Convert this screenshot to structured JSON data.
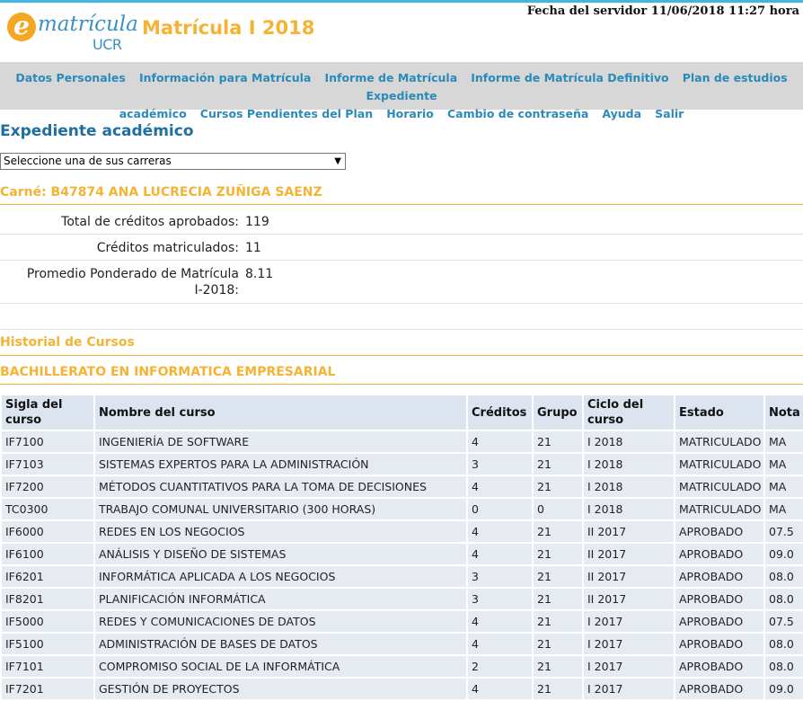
{
  "header": {
    "server_time": "Fecha del servidor 11/06/2018 11:27 hora",
    "logo_e": "e",
    "logo_word": "matrícula",
    "logo_ucr": "UCR",
    "app_title": "Matrícula I 2018"
  },
  "nav": {
    "items": [
      "Datos Personales",
      "Información para Matrícula",
      "Informe de Matrícula",
      "Informe de Matrícula Definitivo",
      "Plan de estudios",
      "Expediente",
      "académico",
      "Cursos Pendientes del Plan",
      "Horario",
      "Cambio de contraseña",
      "Ayuda",
      "Salir"
    ]
  },
  "page": {
    "heading": "Expediente académico",
    "career_select_value": "Seleccione una de sus carreras",
    "carne": "Carné: B47874 ANA LUCRECIA ZUÑIGA SAENZ"
  },
  "summary": {
    "approved_label": "Total de créditos aprobados:",
    "approved_value": "119",
    "enrolled_label": "Créditos matriculados:",
    "enrolled_value": "11",
    "average_label_1": "Promedio Ponderado de Matrícula",
    "average_label_2": "I-2018:",
    "average_value": "8.11"
  },
  "history": {
    "title": "Historial de Cursos",
    "program": "BACHILLERATO EN INFORMATICA EMPRESARIAL"
  },
  "table": {
    "headers": {
      "sigla_1": "Sigla del",
      "sigla_2": "curso",
      "nombre": "Nombre del curso",
      "creditos": "Créditos",
      "grupo": "Grupo",
      "ciclo_1": "Ciclo del",
      "ciclo_2": "curso",
      "estado": "Estado",
      "nota": "Nota"
    },
    "rows": [
      [
        "IF7100",
        "INGENIERÍA DE SOFTWARE",
        "4",
        "21",
        "I 2018",
        "MATRICULADO",
        "MA"
      ],
      [
        "IF7103",
        "SISTEMAS EXPERTOS PARA LA ADMINISTRACIÓN",
        "3",
        "21",
        "I 2018",
        "MATRICULADO",
        "MA"
      ],
      [
        "IF7200",
        "MÉTODOS CUANTITATIVOS PARA LA TOMA DE DECISIONES",
        "4",
        "21",
        "I 2018",
        "MATRICULADO",
        "MA"
      ],
      [
        "TC0300",
        "TRABAJO COMUNAL UNIVERSITARIO (300 HORAS)",
        "0",
        "0",
        "I 2018",
        "MATRICULADO",
        "MA"
      ],
      [
        "IF6000",
        "REDES EN LOS NEGOCIOS",
        "4",
        "21",
        "II 2017",
        "APROBADO",
        "07.5"
      ],
      [
        "IF6100",
        "ANÁLISIS Y DISEÑO DE SISTEMAS",
        "4",
        "21",
        "II 2017",
        "APROBADO",
        "09.0"
      ],
      [
        "IF6201",
        "INFORMÁTICA APLICADA A LOS NEGOCIOS",
        "3",
        "21",
        "II 2017",
        "APROBADO",
        "08.0"
      ],
      [
        "IF8201",
        "PLANIFICACIÓN INFORMÁTICA",
        "3",
        "21",
        "II 2017",
        "APROBADO",
        "08.0"
      ],
      [
        "IF5000",
        "REDES Y COMUNICACIONES DE DATOS",
        "4",
        "21",
        "I 2017",
        "APROBADO",
        "07.5"
      ],
      [
        "IF5100",
        "ADMINISTRACIÓN DE BASES DE DATOS",
        "4",
        "21",
        "I 2017",
        "APROBADO",
        "08.0"
      ],
      [
        "IF7101",
        "COMPROMISO SOCIAL DE LA INFORMÁTICA",
        "2",
        "21",
        "I 2017",
        "APROBADO",
        "08.0"
      ],
      [
        "IF7201",
        "GESTIÓN DE PROYECTOS",
        "4",
        "21",
        "I 2017",
        "APROBADO",
        "09.0"
      ]
    ]
  }
}
